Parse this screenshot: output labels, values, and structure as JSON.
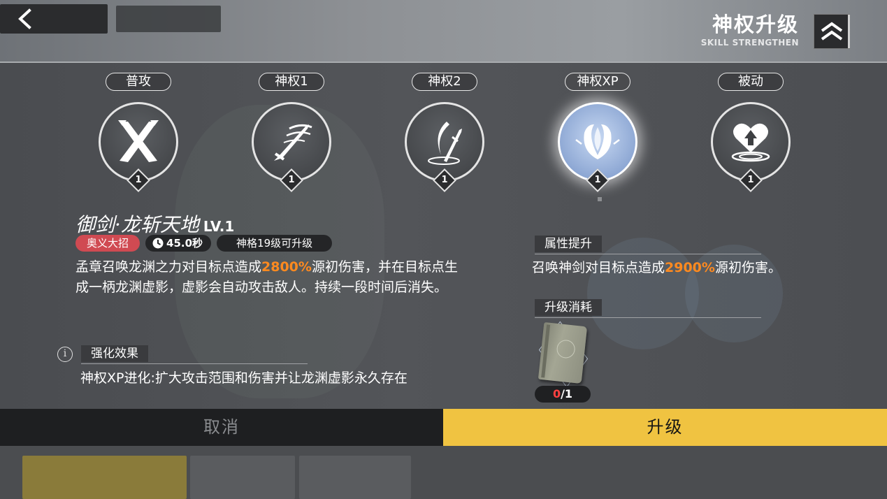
{
  "header": {
    "title": "神权升级",
    "subtitle": "SKILL STRENGTHEN",
    "back_icon": "chevron-left-icon",
    "collapse_icon": "double-chevron-up-icon"
  },
  "skills": [
    {
      "label": "普攻",
      "level": "1",
      "icon": "crossed-swords-icon",
      "active": false
    },
    {
      "label": "神权1",
      "level": "1",
      "icon": "sword-slash-icon",
      "active": false
    },
    {
      "label": "神权2",
      "level": "1",
      "icon": "sword-crescent-icon",
      "active": false
    },
    {
      "label": "神权XP",
      "level": "1",
      "icon": "lotus-blade-icon",
      "active": true
    },
    {
      "label": "被动",
      "level": "1",
      "icon": "heart-up-icon",
      "active": false
    }
  ],
  "detail": {
    "name": "御剑·龙斩天地",
    "level": "LV.1",
    "tag_type": "奥义大招",
    "cooldown": "45.0秒",
    "upgrade_requirement": "神格19级可升级",
    "description_parts": [
      "孟章召唤龙渊之力对目标点造成",
      "2800%",
      "源初伤害，并在目标点生成一柄龙渊虚影，虚影会自动攻击敌人。持续一段时间后消失。"
    ],
    "enhance_title": "强化效果",
    "enhance_text": "神权XP进化:扩大攻击范围和伤害并让龙渊虚影永久存在"
  },
  "attribute": {
    "title": "属性提升",
    "text_parts": [
      "召唤神剑对目标点造成",
      "2900%",
      "源初伤害。"
    ]
  },
  "cost": {
    "title": "升级消耗",
    "item_icon": "skill-book-icon",
    "have": "0",
    "need": "/1"
  },
  "actions": {
    "cancel": "取消",
    "upgrade": "升级"
  },
  "colors": {
    "highlight": "#ff8a1f",
    "upgrade_button": "#f0c341",
    "tag_red": "#d04a52"
  }
}
